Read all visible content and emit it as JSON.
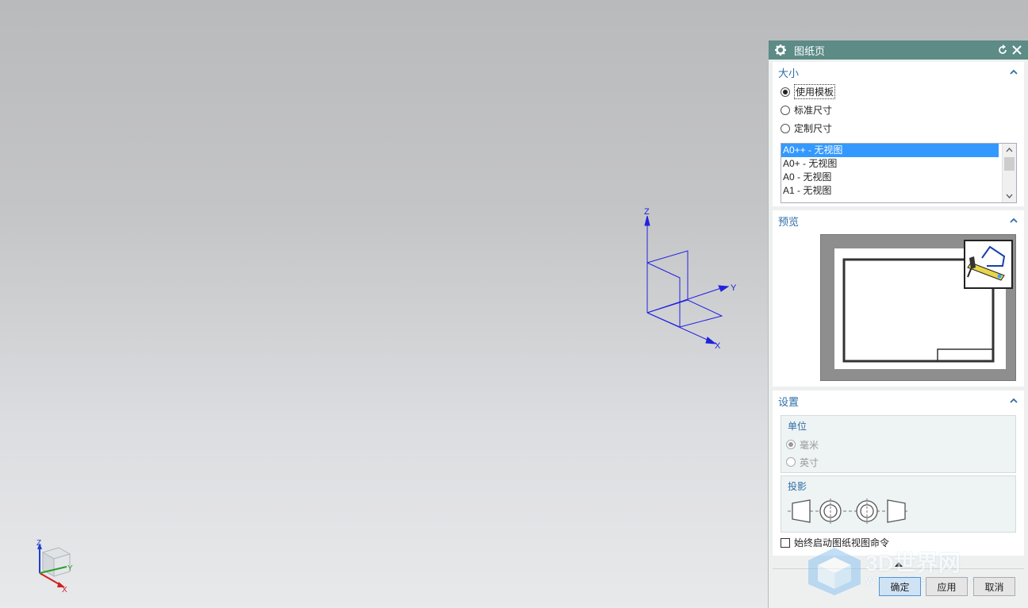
{
  "viewport": {
    "axes": {
      "z": "Z",
      "y": "Y",
      "x": "X"
    },
    "triad": {
      "z": "Z",
      "y": "Y",
      "x": "X"
    }
  },
  "dialog": {
    "title": "图纸页",
    "size_section": {
      "title": "大小",
      "options": [
        {
          "label": "使用模板",
          "selected": true
        },
        {
          "label": "标准尺寸",
          "selected": false
        },
        {
          "label": "定制尺寸",
          "selected": false
        }
      ],
      "templates": [
        "A0++ - 无视图",
        "A0+ - 无视图",
        "A0 - 无视图",
        "A1 - 无视图"
      ],
      "selected_template": "A0++ - 无视图"
    },
    "preview_section": {
      "title": "预览"
    },
    "settings_section": {
      "title": "设置",
      "units": {
        "title": "单位",
        "options": [
          {
            "label": "毫米",
            "selected": true
          },
          {
            "label": "英寸",
            "selected": false
          }
        ]
      },
      "projection": {
        "title": "投影"
      },
      "always_start_checkbox": {
        "label": "始终启动图纸视图命令",
        "checked": false
      }
    },
    "buttons": {
      "ok": "确定",
      "apply": "应用",
      "cancel": "取消"
    }
  },
  "watermark": {
    "text": "3D世界网",
    "url": "WWW.3DSJW.COM"
  },
  "colors": {
    "titlebar": "#5d8b86",
    "section_title": "#2f6ea8",
    "selection": "#3399ff",
    "wcs_axes": "#1a1adb"
  }
}
